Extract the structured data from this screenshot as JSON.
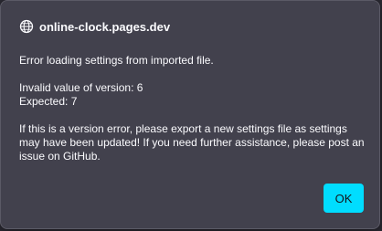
{
  "dialog": {
    "origin": "online-clock.pages.dev",
    "icon": "globe-icon",
    "message": {
      "line1": "Error loading settings from imported file.",
      "line2": "Invalid value of version: 6\nExpected: 7",
      "line3": "If this is a version error, please export a new settings file as settings may have been updated! If you need further assistance, please post an issue on GitHub."
    },
    "ok_label": "OK"
  },
  "colors": {
    "dialog_bg": "#42414d",
    "button_bg": "#00ddff",
    "text": "#fbfbfe"
  }
}
